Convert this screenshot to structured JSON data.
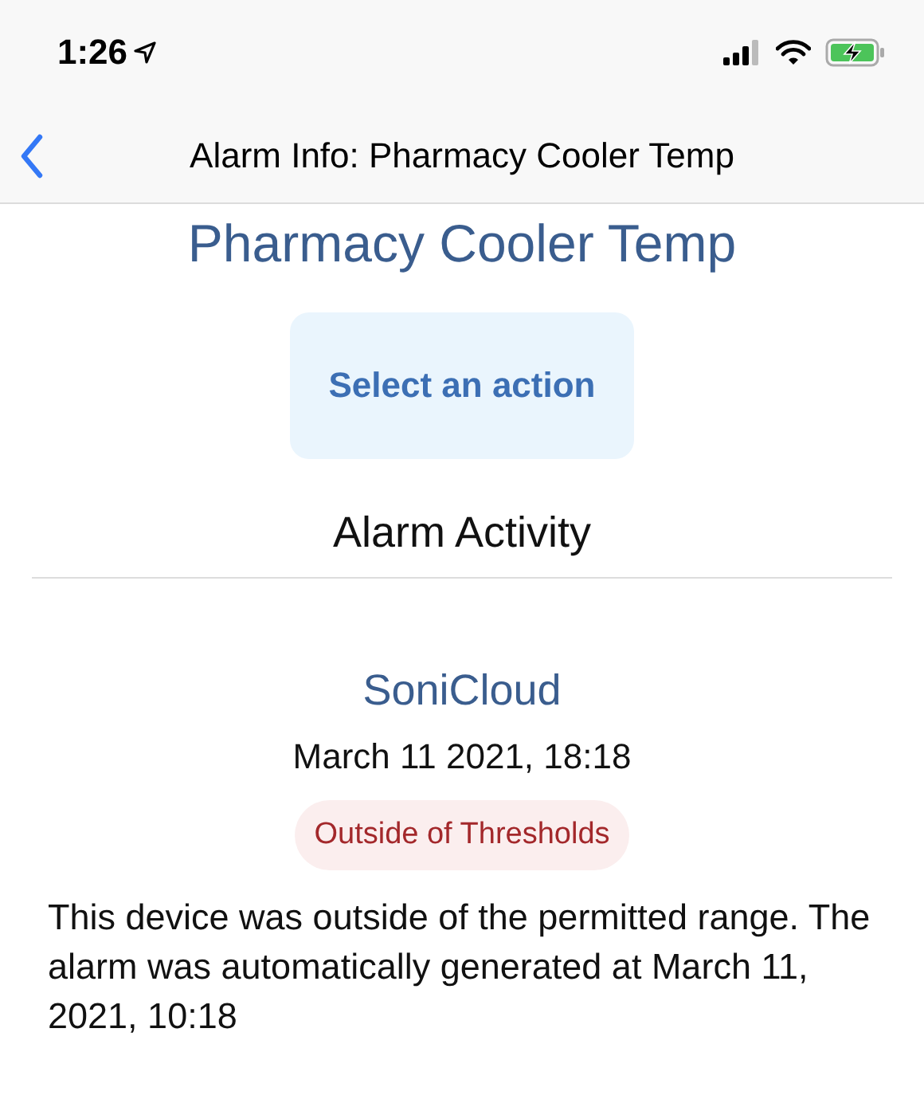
{
  "status_bar": {
    "time": "1:26"
  },
  "nav_bar": {
    "title": "Alarm Info: Pharmacy Cooler Temp"
  },
  "heading": "Pharmacy Cooler Temp",
  "action_button": "Select an action",
  "section_title": "Alarm Activity",
  "activity": [
    {
      "source": "SoniCloud",
      "timestamp": "March 11 2021, 18:18",
      "status": "Outside of Thresholds",
      "kind": "alert",
      "description": "This device was outside of the permitted range. The alarm was automatically generated at March 11, 2021, 10:18"
    }
  ]
}
